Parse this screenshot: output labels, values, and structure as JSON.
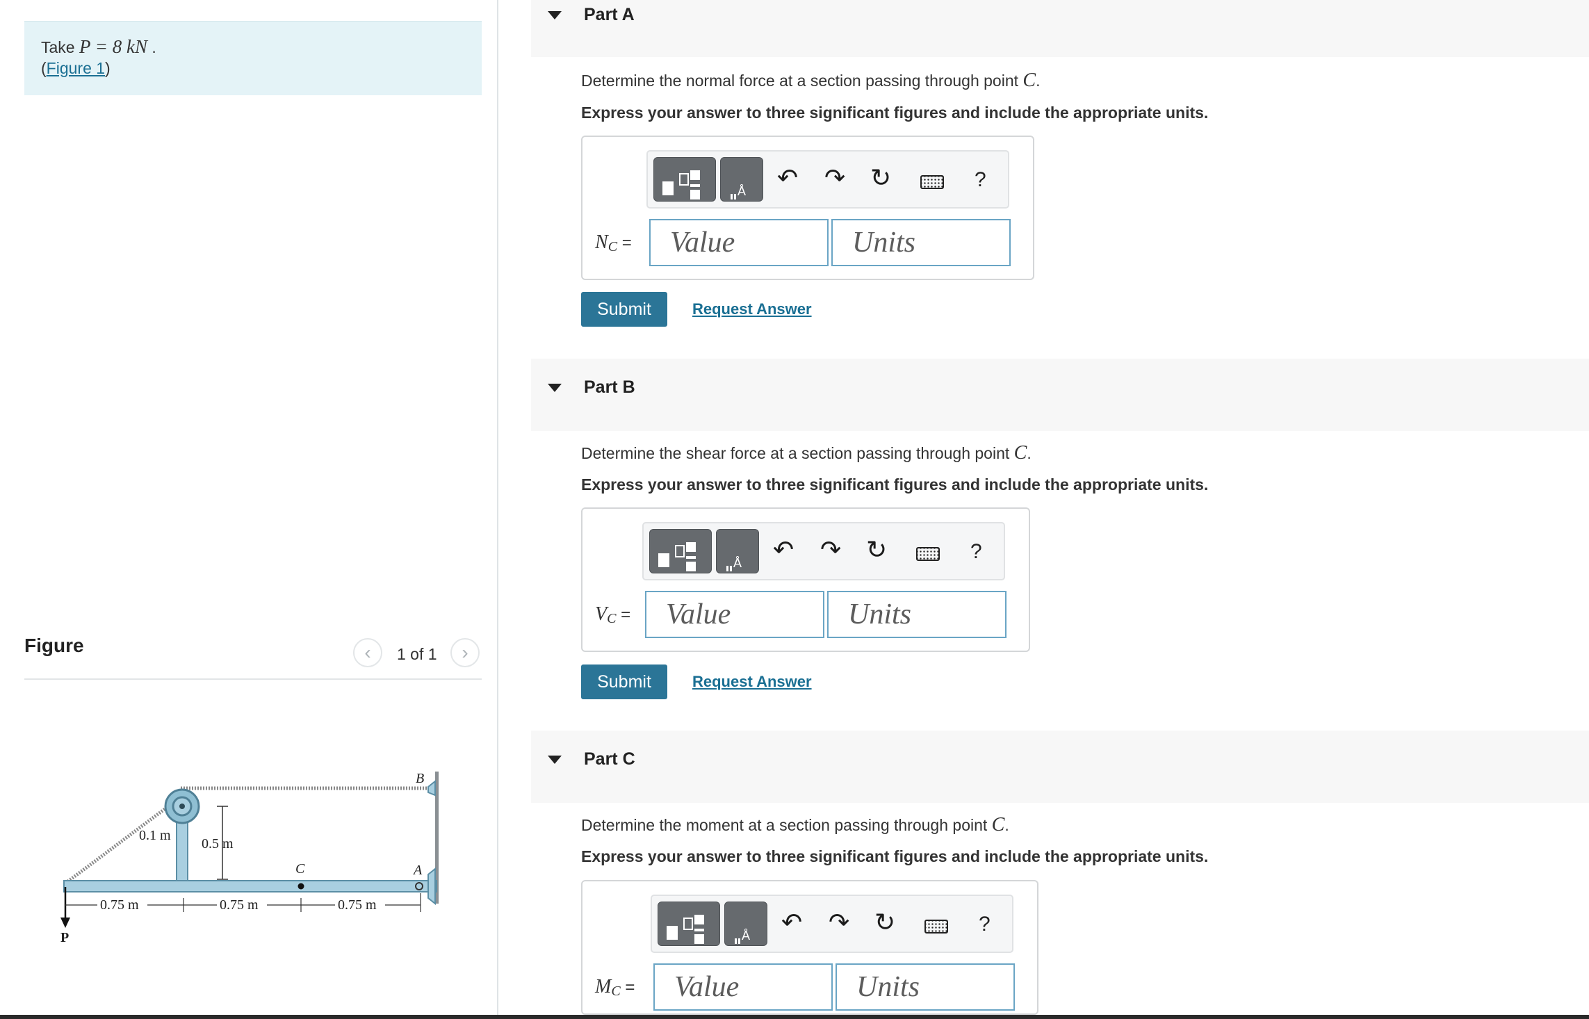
{
  "intro": {
    "prefix": "Take ",
    "math": "P = 8 kN",
    "suffix": " .",
    "open_paren": "(",
    "figure_link": "Figure 1",
    "close_paren": ")"
  },
  "figure_panel": {
    "heading": "Figure",
    "pager_text": "1 of 1",
    "prev_icon": "chevron-left-icon",
    "next_icon": "chevron-right-icon",
    "labels": {
      "p": "P",
      "a": "A",
      "b": "B",
      "c": "C",
      "r": "0.1 m",
      "h": "0.5 m",
      "d1": "0.75 m",
      "d2": "0.75 m",
      "d3": "0.75 m"
    }
  },
  "parts": [
    {
      "title": "Part A",
      "question_pre": "Determine the normal force at a section passing through point ",
      "question_math": "C",
      "question_post": ".",
      "instruction": "Express your answer to three significant figures and include the appropriate units.",
      "label_var": "N",
      "label_sub": "C",
      "label_eq": " =",
      "value_placeholder": "Value",
      "units_placeholder": "Units",
      "submit": "Submit",
      "request": "Request Answer"
    },
    {
      "title": "Part B",
      "question_pre": "Determine the shear force at a section passing through point ",
      "question_math": "C",
      "question_post": ".",
      "instruction": "Express your answer to three significant figures and include the appropriate units.",
      "label_var": "V",
      "label_sub": "C",
      "label_eq": " =",
      "value_placeholder": "Value",
      "units_placeholder": "Units",
      "submit": "Submit",
      "request": "Request Answer"
    },
    {
      "title": "Part C",
      "question_pre": "Determine the moment at a section passing through point ",
      "question_math": "C",
      "question_post": ".",
      "instruction": "Express your answer to three significant figures and include the appropriate units.",
      "label_var": "M",
      "label_sub": "C",
      "label_eq": " =",
      "value_placeholder": "Value",
      "units_placeholder": "Units"
    }
  ],
  "toolbar": {
    "undo_glyph": "↶",
    "redo_glyph": "↷",
    "reset_glyph": "↻",
    "help_glyph": "?",
    "icons": [
      "templates-icon",
      "symbols-icon",
      "undo-icon",
      "redo-icon",
      "reset-icon",
      "keyboard-icon",
      "help-icon"
    ]
  },
  "colors": {
    "intro_bg": "#e4f3f7",
    "link": "#1a6f93",
    "submit_bg": "#2b7597",
    "input_border": "#6aa5c5",
    "beam_fill": "#a9cfe0"
  }
}
